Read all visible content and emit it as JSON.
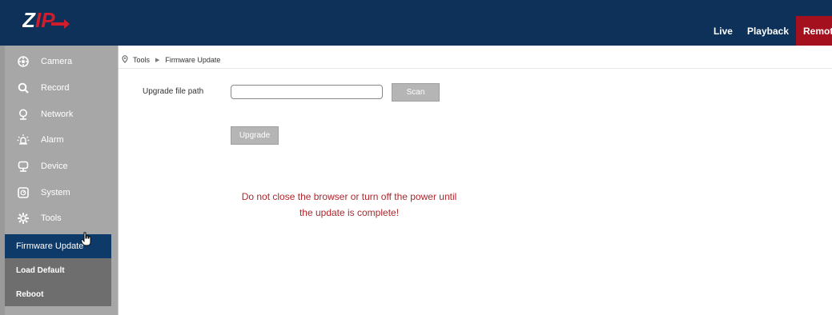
{
  "header": {
    "logo_text": "ZIP",
    "nav": [
      {
        "label": "Live"
      },
      {
        "label": "Playback"
      },
      {
        "label": "Remote"
      }
    ]
  },
  "sidebar": {
    "items": [
      {
        "label": "Camera",
        "icon": "camera-icon"
      },
      {
        "label": "Record",
        "icon": "search-icon"
      },
      {
        "label": "Network",
        "icon": "network-icon"
      },
      {
        "label": "Alarm",
        "icon": "alarm-icon"
      },
      {
        "label": "Device",
        "icon": "device-icon"
      },
      {
        "label": "System",
        "icon": "system-icon"
      },
      {
        "label": "Tools",
        "icon": "gear-icon"
      }
    ],
    "submenu": [
      {
        "label": "Firmware Update",
        "active": true
      },
      {
        "label": "Load Default"
      },
      {
        "label": "Reboot"
      }
    ]
  },
  "breadcrumb": {
    "items": [
      "Tools",
      "Firmware Update"
    ]
  },
  "form": {
    "path_label": "Upgrade file path",
    "path_value": "",
    "scan_label": "Scan",
    "upgrade_label": "Upgrade"
  },
  "warning": {
    "line1": "Do not close the browser or turn off the power until",
    "line2": "the update is complete!"
  },
  "colors": {
    "header": "#0d3158",
    "active_nav": "#a4101e",
    "sidebar": "#a7a7a7",
    "submenu": "#6e6e6e",
    "submenu_active": "#0d3a68",
    "warning": "#b0252c"
  }
}
